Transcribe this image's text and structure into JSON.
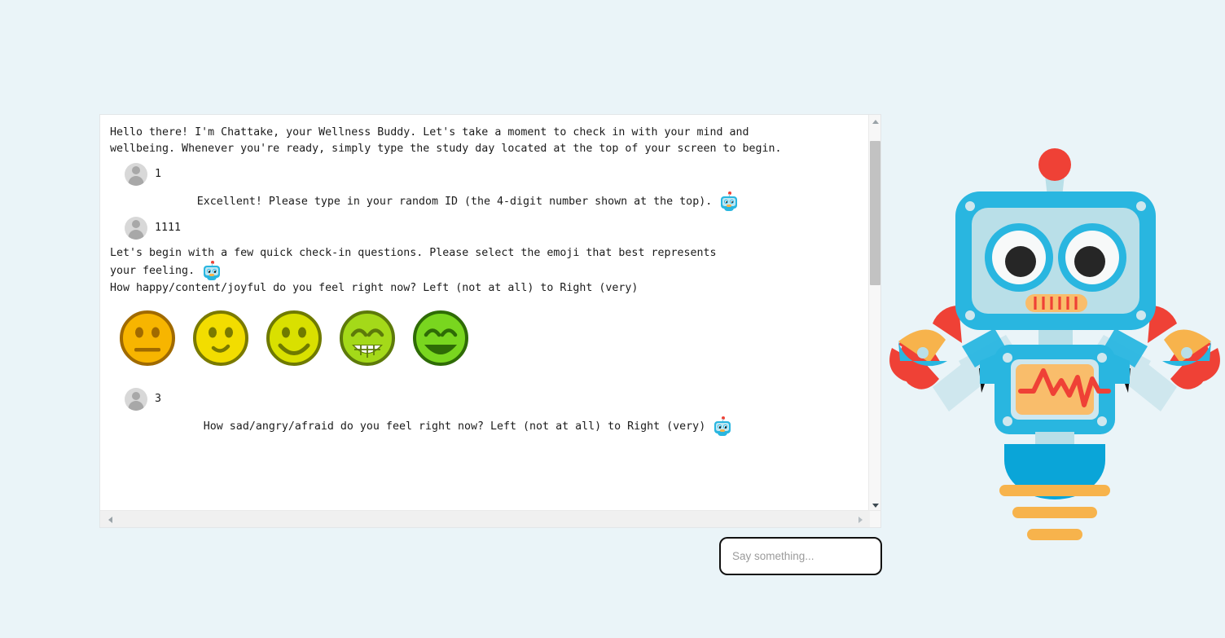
{
  "page": {
    "background_color": "#eaf4f8",
    "panel_background": "#ffffff"
  },
  "chat": {
    "messages": [
      {
        "role": "bot",
        "align": "left",
        "avatar": "robot-avatar-icon",
        "show_avatar": false,
        "text": "Hello there! I'm Chattake, your Wellness Buddy. Let's take a moment to check in with your mind and\nwellbeing. Whenever you're ready, simply type the study day located at the top of your screen to begin."
      },
      {
        "role": "user",
        "avatar": "user-avatar-icon",
        "text": "1"
      },
      {
        "role": "bot",
        "align": "center",
        "avatar": "robot-avatar-icon",
        "show_avatar": true,
        "text": "Excellent! Please type in your random ID (the 4-digit number shown at the top)."
      },
      {
        "role": "user",
        "avatar": "user-avatar-icon",
        "text": "1111"
      },
      {
        "role": "bot",
        "align": "left",
        "avatar": "robot-avatar-icon",
        "show_avatar": true,
        "text": "Let's begin with a few quick check-in questions. Please select the emoji that best represents\nyour feeling."
      },
      {
        "role": "bot",
        "align": "left",
        "avatar": "robot-avatar-icon",
        "show_avatar": false,
        "text": "How happy/content/joyful do you feel right now? Left (not at all) to Right (very)"
      },
      {
        "role": "user",
        "avatar": "user-avatar-icon",
        "text": "3"
      },
      {
        "role": "bot",
        "align": "center",
        "avatar": "robot-avatar-icon",
        "show_avatar": true,
        "text": "How sad/angry/afraid do you feel right now? Left (not at all) to Right (very)"
      }
    ],
    "emoji_scale": {
      "label": "happiness-rating-scale",
      "options": [
        {
          "value": 1,
          "name": "neutral-face-emoji",
          "fill": "#f7b500",
          "stroke": "#a06a00",
          "mouth": "flat",
          "eyes": "oval"
        },
        {
          "value": 2,
          "name": "slight-smile-emoji",
          "fill": "#f2dd00",
          "stroke": "#7a7a00",
          "mouth": "small-smile",
          "eyes": "oval"
        },
        {
          "value": 3,
          "name": "smiling-face-emoji",
          "fill": "#d9e000",
          "stroke": "#6f7a00",
          "mouth": "smile",
          "eyes": "oval"
        },
        {
          "value": 4,
          "name": "grinning-teeth-emoji",
          "fill": "#a4d919",
          "stroke": "#5d7a0a",
          "mouth": "teeth",
          "eyes": "arc"
        },
        {
          "value": 5,
          "name": "open-mouth-laugh-emoji",
          "fill": "#79d61f",
          "stroke": "#2e6b06",
          "mouth": "open",
          "eyes": "arc"
        }
      ]
    },
    "scrollbars": {
      "vertical": {
        "name": "vertical-scrollbar",
        "thumb_top_pct": 3.5,
        "thumb_height_pct": 39
      },
      "horizontal": {
        "name": "horizontal-scrollbar"
      }
    }
  },
  "input": {
    "name": "message-input",
    "placeholder": "Say something...",
    "value": ""
  },
  "mascot": {
    "name": "robot-mascot-illustration",
    "colors": {
      "body_blue": "#29b6e0",
      "face_light": "#b9dfe8",
      "antenna_red": "#ef4136",
      "limb_light": "#cfe7ee",
      "screen_orange": "#f9bd6b",
      "heartbeat_red": "#ef4136",
      "hand_red": "#ef4136",
      "hand_orange": "#f7b34c",
      "eye_white": "#f7f9f9",
      "pupil": "#262626"
    }
  }
}
